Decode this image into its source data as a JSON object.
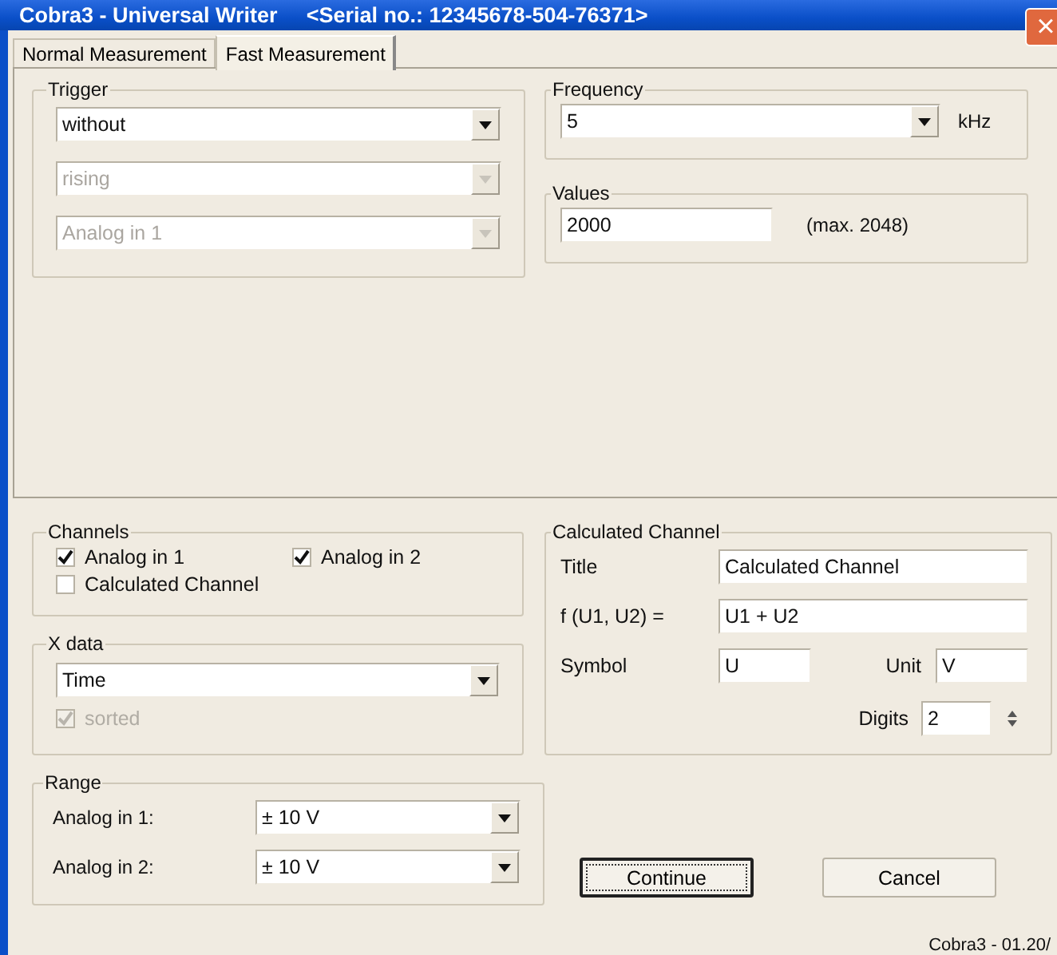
{
  "window": {
    "title": "Cobra3 - Universal Writer",
    "subtitle": "<Serial no.: 12345678-504-76371>",
    "close": "×"
  },
  "tabs": [
    {
      "label": "Normal Measurement",
      "selected": false
    },
    {
      "label": "Fast Measurement",
      "selected": true
    }
  ],
  "trigger": {
    "label": "Trigger",
    "dropdowns": [
      {
        "value": "without",
        "disabled": false
      },
      {
        "value": "rising",
        "disabled": true
      },
      {
        "value": "Analog in 1",
        "disabled": true
      }
    ]
  },
  "frequency": {
    "label": "Frequency",
    "value": "5",
    "unit": "kHz"
  },
  "values": {
    "label": "Values",
    "value": "2000",
    "hint": "(max. 2048)"
  },
  "channels": {
    "label": "Channels",
    "items": [
      {
        "label": "Analog in 1",
        "checked": true
      },
      {
        "label": "Analog in 2",
        "checked": true
      },
      {
        "label": "Calculated Channel",
        "checked": false
      }
    ]
  },
  "x_data": {
    "label": "X data",
    "value": "Time",
    "sorted": {
      "label": "sorted",
      "checked": true,
      "disabled": true
    }
  },
  "range": {
    "label": "Range",
    "rows": [
      {
        "label": "Analog in 1:",
        "value": "± 10 V"
      },
      {
        "label": "Analog in 2:",
        "value": "± 10 V"
      }
    ]
  },
  "calculated_channel": {
    "label": "Calculated Channel",
    "title_label": "Title",
    "title_value": "Calculated Channel",
    "formula_label": "f (U1, U2) =",
    "formula_value": "U1 + U2",
    "symbol_label": "Symbol",
    "symbol_value": "U",
    "unit_label": "Unit",
    "unit_value": "V",
    "digits_label": "Digits",
    "digits_value": "2"
  },
  "buttons": [
    {
      "label": "Continue",
      "default": true
    },
    {
      "label": "Cancel",
      "default": false
    }
  ],
  "status": "Cobra3 - 01.20/"
}
